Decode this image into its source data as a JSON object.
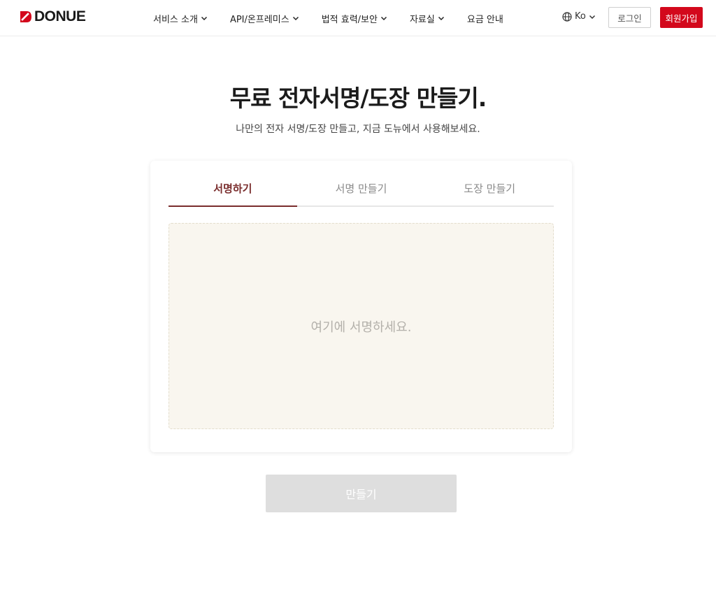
{
  "header": {
    "logo_text": "DONUE",
    "nav": [
      {
        "label": "서비스 소개",
        "has_dropdown": true
      },
      {
        "label": "API/온프레미스",
        "has_dropdown": true
      },
      {
        "label": "법적 효력/보안",
        "has_dropdown": true
      },
      {
        "label": "자료실",
        "has_dropdown": true
      },
      {
        "label": "요금 안내",
        "has_dropdown": false
      }
    ],
    "language": "Ko",
    "login_label": "로그인",
    "signup_label": "회원가입"
  },
  "hero": {
    "title": "무료 전자서명/도장 만들기.",
    "subtitle": "나만의 전자 서명/도장 만들고, 지금 도뉴에서 사용해보세요."
  },
  "card": {
    "tabs": [
      {
        "label": "서명하기",
        "active": true
      },
      {
        "label": "서명 만들기",
        "active": false
      },
      {
        "label": "도장 만들기",
        "active": false
      }
    ],
    "sign_placeholder": "여기에 서명하세요."
  },
  "create_button_label": "만들기",
  "colors": {
    "brand_red": "#d3081c",
    "active_tab": "#7a2d2d",
    "sign_area_bg": "#f9f6ef",
    "disabled_button": "#dedede"
  },
  "icons": {
    "logo": "donue-logo-mark",
    "dropdown": "chevron-down-icon",
    "language": "globe-icon"
  }
}
